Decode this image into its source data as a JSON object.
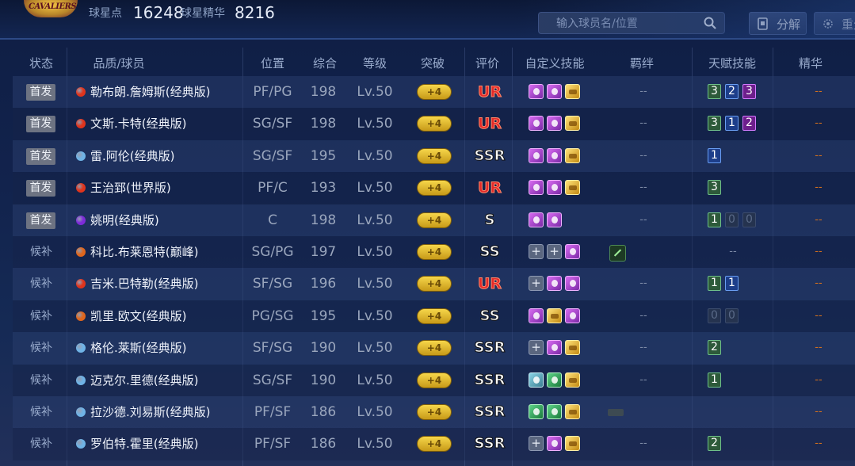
{
  "header": {
    "logo_alt": "CAVALIERS",
    "star_points_label": "球星点",
    "star_points_value": "16248",
    "star_essence_label": "球星精华",
    "star_essence_value": "8216",
    "search_placeholder": "输入球员名/位置",
    "decompose_label": "分解",
    "reset_label": "重生"
  },
  "columns": [
    "状态",
    "品质/球员",
    "位置",
    "综合",
    "等级",
    "突破",
    "评价",
    "自定义技能",
    "羁绊",
    "天赋技能",
    "精华"
  ],
  "players": [
    {
      "status": "首发",
      "starter": true,
      "quality": "red",
      "name": "勒布朗.詹姆斯(经典版)",
      "pos": "PF/PG",
      "overall": "198",
      "level": "Lv.50",
      "break": "+4",
      "grade": "UR",
      "skills": [
        "purple",
        "purple",
        "gold"
      ],
      "bond": "--",
      "talents": [
        {
          "v": "3",
          "c": "green"
        },
        {
          "v": "2",
          "c": "blue"
        },
        {
          "v": "3",
          "c": "purple"
        }
      ],
      "essence": "--"
    },
    {
      "status": "首发",
      "starter": true,
      "quality": "red",
      "name": "文斯.卡特(经典版)",
      "pos": "SG/SF",
      "overall": "198",
      "level": "Lv.50",
      "break": "+4",
      "grade": "UR",
      "skills": [
        "purple",
        "purple",
        "gold"
      ],
      "bond": "--",
      "talents": [
        {
          "v": "3",
          "c": "green"
        },
        {
          "v": "1",
          "c": "blue"
        },
        {
          "v": "2",
          "c": "purple"
        }
      ],
      "essence": "--"
    },
    {
      "status": "首发",
      "starter": true,
      "quality": "blue",
      "name": "雷.阿伦(经典版)",
      "pos": "SG/SF",
      "overall": "195",
      "level": "Lv.50",
      "break": "+4",
      "grade": "SSR",
      "skills": [
        "purple",
        "purple",
        "gold"
      ],
      "bond": "--",
      "talents": [
        {
          "v": "1",
          "c": "blue"
        }
      ],
      "essence": "--"
    },
    {
      "status": "首发",
      "starter": true,
      "quality": "red",
      "name": "王治郅(世界版)",
      "pos": "PF/C",
      "overall": "193",
      "level": "Lv.50",
      "break": "+4",
      "grade": "UR",
      "skills": [
        "purple",
        "purple",
        "gold"
      ],
      "bond": "--",
      "talents": [
        {
          "v": "3",
          "c": "green"
        }
      ],
      "essence": "--"
    },
    {
      "status": "首发",
      "starter": true,
      "quality": "purple",
      "name": "姚明(经典版)",
      "pos": "C",
      "overall": "198",
      "level": "Lv.50",
      "break": "+4",
      "grade": "S",
      "skills": [
        "purple",
        "purple"
      ],
      "bond": "--",
      "talents": [
        {
          "v": "1",
          "c": "green"
        },
        {
          "v": "0",
          "c": "dim"
        },
        {
          "v": "0",
          "c": "dim"
        }
      ],
      "essence": "--"
    },
    {
      "status": "候补",
      "starter": false,
      "quality": "orange",
      "name": "科比.布莱恩特(巅峰)",
      "pos": "SG/PG",
      "overall": "197",
      "level": "Lv.50",
      "break": "+4",
      "grade": "SS",
      "skills": [
        "plus",
        "plus",
        "purple"
      ],
      "bond": "icon",
      "talents": [],
      "talent_text": "--",
      "essence": "--"
    },
    {
      "status": "候补",
      "starter": false,
      "quality": "red",
      "name": "吉米.巴特勒(经典版)",
      "pos": "SF/SG",
      "overall": "196",
      "level": "Lv.50",
      "break": "+4",
      "grade": "UR",
      "skills": [
        "plus",
        "purple",
        "purple"
      ],
      "bond": "--",
      "talents": [
        {
          "v": "1",
          "c": "green"
        },
        {
          "v": "1",
          "c": "blue"
        }
      ],
      "essence": "--"
    },
    {
      "status": "候补",
      "starter": false,
      "quality": "orange",
      "name": "凯里.欧文(经典版)",
      "pos": "PG/SG",
      "overall": "195",
      "level": "Lv.50",
      "break": "+4",
      "grade": "SS",
      "skills": [
        "purple",
        "gold",
        "purple"
      ],
      "bond": "--",
      "talents": [
        {
          "v": "0",
          "c": "dim"
        },
        {
          "v": "0",
          "c": "dim"
        }
      ],
      "essence": "--"
    },
    {
      "status": "候补",
      "starter": false,
      "quality": "blue",
      "name": "格伦.莱斯(经典版)",
      "pos": "SF/SG",
      "overall": "190",
      "level": "Lv.50",
      "break": "+4",
      "grade": "SSR",
      "skills": [
        "plus",
        "purple",
        "gold"
      ],
      "bond": "--",
      "talents": [
        {
          "v": "2",
          "c": "green"
        }
      ],
      "essence": "--"
    },
    {
      "status": "候补",
      "starter": false,
      "quality": "blue",
      "name": "迈克尔.里德(经典版)",
      "pos": "SG/SF",
      "overall": "190",
      "level": "Lv.50",
      "break": "+4",
      "grade": "SSR",
      "skills": [
        "teal",
        "green",
        "gold"
      ],
      "bond": "--",
      "talents": [
        {
          "v": "1",
          "c": "green"
        }
      ],
      "essence": "--"
    },
    {
      "status": "候补",
      "starter": false,
      "quality": "blue",
      "name": "拉沙德.刘易斯(经典版)",
      "pos": "PF/SF",
      "overall": "186",
      "level": "Lv.50",
      "break": "+4",
      "grade": "SSR",
      "skills": [
        "green",
        "green",
        "gold"
      ],
      "bond": "dim",
      "talents": [],
      "essence": "--"
    },
    {
      "status": "候补",
      "starter": false,
      "quality": "blue",
      "name": "罗伯特.霍里(经典版)",
      "pos": "PF/SF",
      "overall": "186",
      "level": "Lv.50",
      "break": "+4",
      "grade": "SSR",
      "skills": [
        "plus",
        "purple",
        "gold"
      ],
      "bond": "--",
      "talents": [
        {
          "v": "2",
          "c": "green"
        }
      ],
      "essence": "--"
    }
  ],
  "quality_colors": {
    "red": "#e0341c",
    "blue": "#6fb3e6",
    "purple": "#7d2bd8",
    "orange": "#e0661c"
  }
}
